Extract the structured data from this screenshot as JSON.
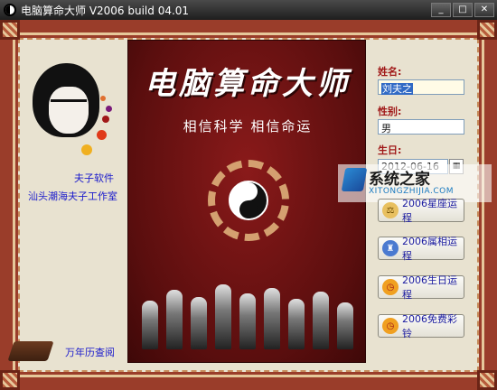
{
  "window": {
    "title": "电脑算命大师 V2006 build 04.01",
    "buttons": [
      "_",
      "□",
      "✕"
    ]
  },
  "left_panel": {
    "brand": "夫子软件",
    "studio": "汕头潮海夫子工作室",
    "calendar_link": "万年历查阅"
  },
  "poster": {
    "title": "电脑算命大师",
    "slogan": "相信科学  相信命运"
  },
  "form": {
    "name_label": "姓名:",
    "name_value": "刘夫之",
    "gender_label": "性别:",
    "gender_value": "男",
    "birthday_label": "生日:",
    "birthday_value": "2012-06-16"
  },
  "actions": [
    {
      "label": "2006星座运程",
      "icon": "scales-icon"
    },
    {
      "label": "2006属相运程",
      "icon": "zodiac-icon"
    },
    {
      "label": "2006生日运程",
      "icon": "alarm-clock-icon"
    },
    {
      "label": "2006免费彩铃",
      "icon": "alarm-clock-icon"
    }
  ],
  "watermark": {
    "main": "系统之家",
    "sub": "XITONGZHIJIA.COM"
  },
  "colors": {
    "frame": "#9a3d2a",
    "poster": "#6a1010",
    "label": "#a01818",
    "link": "#1a1acc"
  }
}
